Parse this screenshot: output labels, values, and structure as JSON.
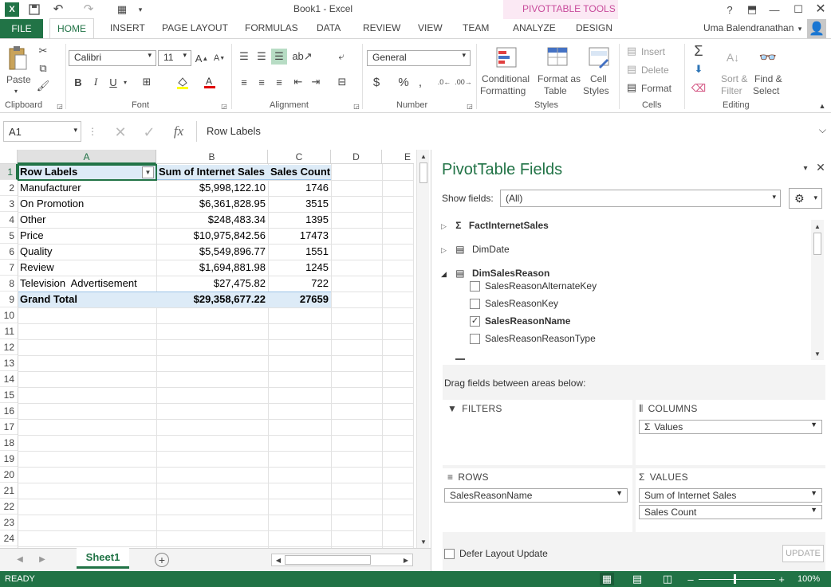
{
  "window": {
    "title": "Book1 - Excel",
    "contextual_tab_group": "PIVOTTABLE TOOLS",
    "user": "Uma Balendranathan"
  },
  "tabs": [
    "FILE",
    "HOME",
    "INSERT",
    "PAGE LAYOUT",
    "FORMULAS",
    "DATA",
    "REVIEW",
    "VIEW",
    "TEAM",
    "ANALYZE",
    "DESIGN"
  ],
  "ribbon": {
    "clipboard": {
      "paste": "Paste",
      "group": "Clipboard"
    },
    "font": {
      "name": "Calibri",
      "size": "11",
      "group": "Font"
    },
    "alignment": {
      "group": "Alignment"
    },
    "number": {
      "format": "General",
      "group": "Number"
    },
    "styles": {
      "conditional1": "Conditional",
      "conditional2": "Formatting",
      "format_as1": "Format as",
      "format_as2": "Table",
      "cell_styles1": "Cell",
      "cell_styles2": "Styles",
      "group": "Styles"
    },
    "cells": {
      "insert": "Insert",
      "delete": "Delete",
      "format": "Format",
      "group": "Cells"
    },
    "editing": {
      "sort1": "Sort &",
      "sort2": "Filter",
      "find1": "Find &",
      "find2": "Select",
      "group": "Editing"
    }
  },
  "formula_bar": {
    "name_box": "A1",
    "fx": "fx",
    "content": "Row Labels"
  },
  "sheet": {
    "columns": [
      "A",
      "B",
      "C",
      "D",
      "E"
    ],
    "header": {
      "row": "1",
      "a": "Row Labels",
      "b": "Sum of Internet Sales",
      "c": "Sales Count"
    },
    "rows": [
      {
        "n": "2",
        "a": "Manufacturer",
        "b": "$5,998,122.10",
        "c": "1746"
      },
      {
        "n": "3",
        "a": "On Promotion",
        "b": "$6,361,828.95",
        "c": "3515"
      },
      {
        "n": "4",
        "a": "Other",
        "b": "$248,483.34",
        "c": "1395"
      },
      {
        "n": "5",
        "a": "Price",
        "b": "$10,975,842.56",
        "c": "17473"
      },
      {
        "n": "6",
        "a": "Quality",
        "b": "$5,549,896.77",
        "c": "1551"
      },
      {
        "n": "7",
        "a": "Review",
        "b": "$1,694,881.98",
        "c": "1245"
      },
      {
        "n": "8",
        "a": "Television  Advertisement",
        "b": "$27,475.82",
        "c": "722"
      }
    ],
    "total": {
      "n": "9",
      "a": "Grand Total",
      "b": "$29,358,677.22",
      "c": "27659"
    },
    "empty_rows": [
      "10",
      "11",
      "12",
      "13",
      "14",
      "15",
      "16",
      "17",
      "18",
      "19",
      "20",
      "21",
      "22",
      "23",
      "24"
    ],
    "sheet_tab": "Sheet1"
  },
  "pivot_pane": {
    "title": "PivotTable Fields",
    "show_fields_label": "Show fields:",
    "show_fields_value": "(All)",
    "tables": [
      "FactInternetSales",
      "DimDate",
      "DimSalesReason"
    ],
    "fields": [
      {
        "name": "SalesReasonAlternateKey",
        "checked": false
      },
      {
        "name": "SalesReasonKey",
        "checked": false
      },
      {
        "name": "SalesReasonName",
        "checked": true
      },
      {
        "name": "SalesReasonReasonType",
        "checked": false
      }
    ],
    "drag_label": "Drag fields between areas below:",
    "filters": "FILTERS",
    "columns": "COLUMNS",
    "columns_item": "Values",
    "rows": "ROWS",
    "rows_item": "SalesReasonName",
    "values": "VALUES",
    "values_items": [
      "Sum of Internet Sales",
      "Sales Count"
    ],
    "defer": "Defer Layout Update",
    "update": "UPDATE"
  },
  "status": {
    "ready": "READY",
    "zoom": "100%"
  },
  "colors": {
    "accent": "#217346",
    "contextual": "#c84b9b",
    "header_fill": "#ddebf7"
  }
}
